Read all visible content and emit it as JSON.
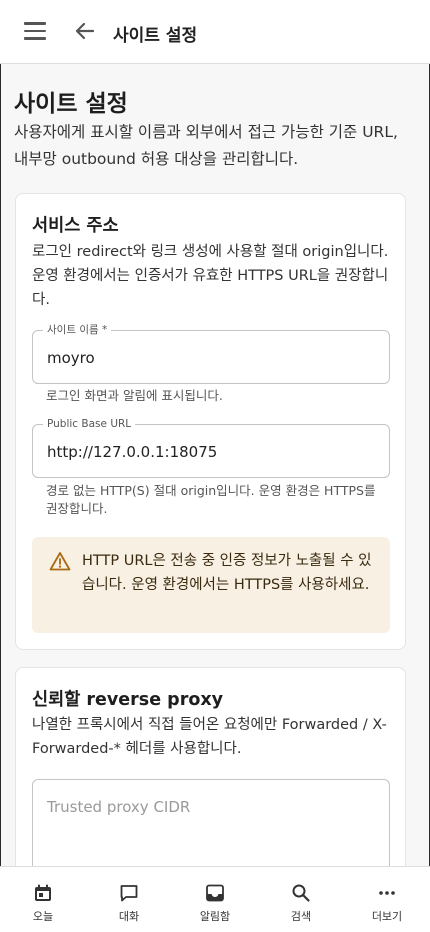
{
  "appbar": {
    "title": "사이트 설정",
    "menu_icon": "hamburger-menu-icon",
    "back_icon": "arrow-left-icon"
  },
  "page": {
    "title": "사이트 설정",
    "description": "사용자에게 표시할 이름과 외부에서 접근 가능한 기준 URL, 내부망 outbound 허용 대상을 관리합니다."
  },
  "service_card": {
    "title": "서비스 주소",
    "description": "로그인 redirect와 링크 생성에 사용할 절대 origin입니다. 운영 환경에서는 인증서가 유효한 HTTPS URL을 권장합니다.",
    "site_name": {
      "label": "사이트 이름 *",
      "value": "moyro",
      "helper": "로그인 화면과 알림에 표시됩니다."
    },
    "public_base_url": {
      "label": "Public Base URL",
      "value": "http://127.0.0.1:18075",
      "helper": "경로 없는 HTTP(S) 절대 origin입니다. 운영 환경은 HTTPS를 권장합니다."
    },
    "alert": {
      "icon": "warning-triangle-icon",
      "text": "HTTP URL은 전송 중 인증 정보가 노출될 수 있습니다. 운영 환경에서는 HTTPS를 사용하세요.",
      "background": "#f8f0e3"
    }
  },
  "proxy_card": {
    "title": "신뢰할 reverse proxy",
    "description": "나열한 프록시에서 직접 들어온 요청에만 Forwarded / X-Forwarded-* 헤더를 사용합니다.",
    "trusted_proxy": {
      "placeholder": "Trusted proxy CIDR"
    }
  },
  "bottom_nav": [
    {
      "label": "오늘",
      "icon": "calendar-icon"
    },
    {
      "label": "대화",
      "icon": "chat-bubble-icon"
    },
    {
      "label": "알림함",
      "icon": "inbox-icon"
    },
    {
      "label": "검색",
      "icon": "search-icon"
    },
    {
      "label": "더보기",
      "icon": "more-dots-icon"
    }
  ]
}
